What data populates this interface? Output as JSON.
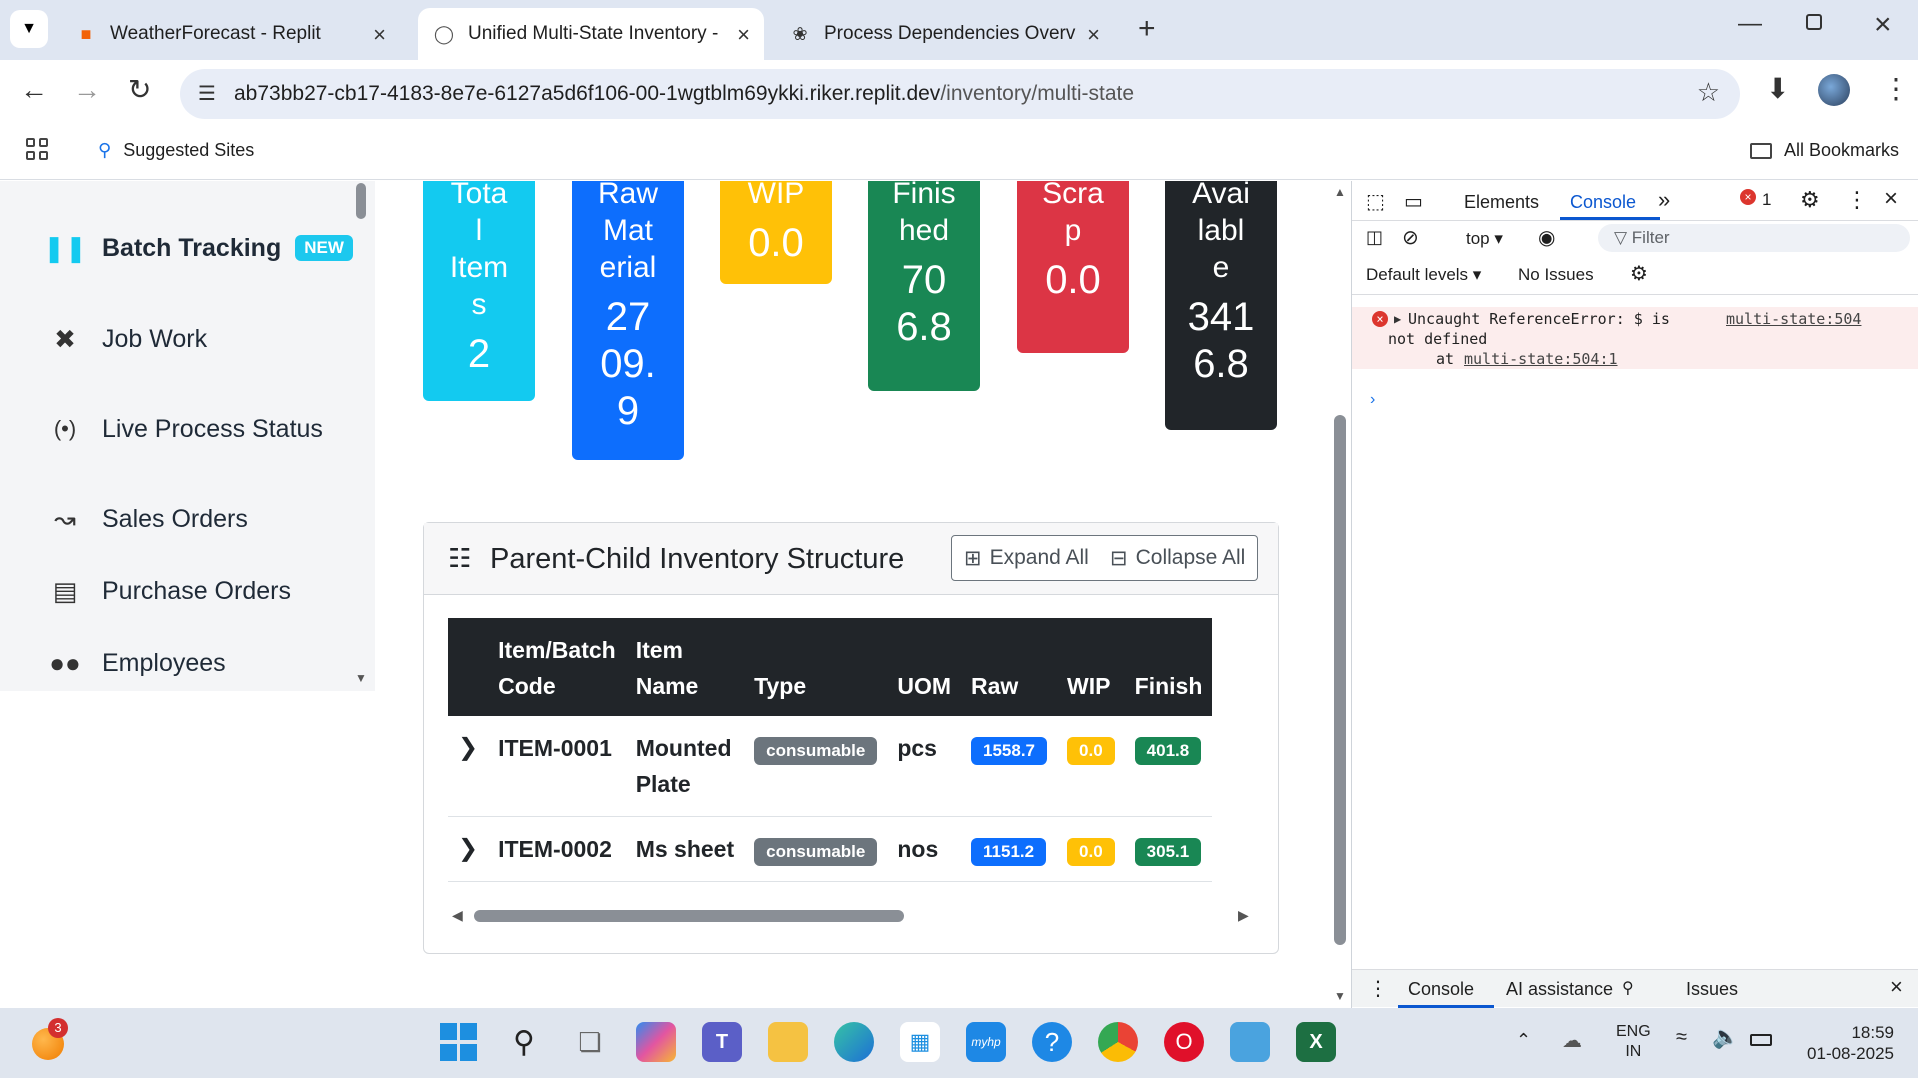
{
  "browser": {
    "tabs": [
      {
        "title": "WeatherForecast - Replit",
        "active": false
      },
      {
        "title": "Unified Multi-State Inventory - /",
        "active": true
      },
      {
        "title": "Process Dependencies Overview",
        "active": false
      }
    ],
    "url_host": "ab73bb27-cb17-4183-8e7e-6127a5d6f106-00-1wgtblm69ykki.riker.replit.dev",
    "url_path": "/inventory/multi-state",
    "bookmarks": {
      "suggested": "Suggested Sites",
      "all": "All Bookmarks"
    }
  },
  "sidebar": {
    "items": [
      {
        "label": "Batch Tracking",
        "badge": "NEW",
        "icon": "barcode-icon"
      },
      {
        "label": "Job Work",
        "icon": "tools-icon"
      },
      {
        "label": "Live Process Status",
        "icon": "broadcast-icon"
      },
      {
        "label": "Sales Orders",
        "icon": "chart-line-icon"
      },
      {
        "label": "Purchase Orders",
        "icon": "file-invoice-icon"
      },
      {
        "label": "Employees",
        "icon": "users-icon"
      }
    ]
  },
  "summary_cards": [
    {
      "label_lines": [
        "Tota",
        "l",
        "Item",
        "s"
      ],
      "value_lines": [
        "2"
      ],
      "color": "#13caf0"
    },
    {
      "label_lines": [
        "Raw",
        "Mat",
        "erial"
      ],
      "value_lines": [
        "27",
        "09.",
        "9"
      ],
      "color": "#0d6efd"
    },
    {
      "label_lines": [
        "WIP"
      ],
      "value_lines": [
        "0.0"
      ],
      "color": "#ffc107"
    },
    {
      "label_lines": [
        "Finis",
        "hed"
      ],
      "value_lines": [
        "70",
        "6.8"
      ],
      "color": "#198754"
    },
    {
      "label_lines": [
        "Scra",
        "p"
      ],
      "value_lines": [
        "0.0"
      ],
      "color": "#dc3545"
    },
    {
      "label_lines": [
        "Avai",
        "labl",
        "e"
      ],
      "value_lines": [
        "341",
        "6.8"
      ],
      "color": "#212529"
    }
  ],
  "structure": {
    "title": "Parent-Child Inventory Structure",
    "expand_label": "Expand All",
    "collapse_label": "Collapse All",
    "columns": [
      "Item/Batch\nCode",
      "Item\nName",
      "Type",
      "UOM",
      "Raw",
      "WIP",
      "Finish"
    ],
    "rows": [
      {
        "code": "ITEM-0001",
        "name": "Mounted\nPlate",
        "type": "consumable",
        "uom": "pcs",
        "raw": "1558.7",
        "wip": "0.0",
        "finished": "401.8"
      },
      {
        "code": "ITEM-0002",
        "name": "Ms sheet",
        "type": "consumable",
        "uom": "nos",
        "raw": "1151.2",
        "wip": "0.0",
        "finished": "305.1"
      }
    ]
  },
  "devtools": {
    "tabs": [
      "Elements",
      "Console"
    ],
    "active_tab": "Console",
    "error_count": "1",
    "context": "top",
    "filter_placeholder": "Filter",
    "levels": "Default levels",
    "issues": "No Issues",
    "error_line1": "Uncaught ReferenceError: $ is",
    "error_line2": "not defined",
    "error_line3": "at",
    "error_link": "multi-state:504",
    "error_link2": "multi-state:504:1",
    "drawer_tabs": [
      "Console",
      "AI assistance",
      "Issues"
    ]
  },
  "taskbar": {
    "notif_count": "3",
    "lang": "ENG",
    "region": "IN",
    "time": "18:59",
    "date": "01-08-2025"
  }
}
